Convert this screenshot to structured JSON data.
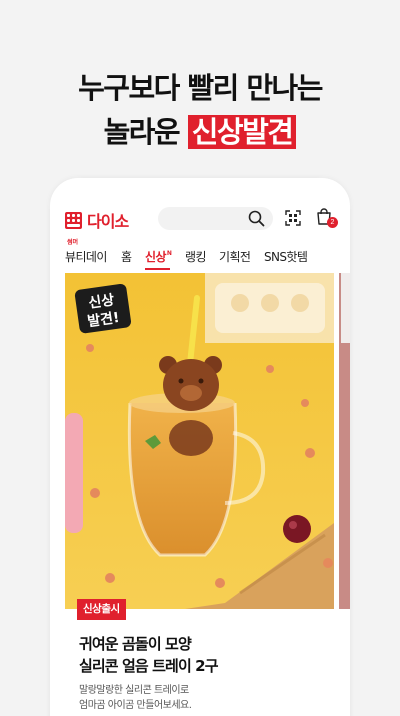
{
  "hero": {
    "line1": "누구보다 빨리 만나는",
    "line2_prefix": "놀라운 ",
    "line2_highlight": "신상발견"
  },
  "app": {
    "logo_text": "다이소",
    "cart_count": "2"
  },
  "tabs": [
    {
      "label": "뷰티데이",
      "hint": "썸머"
    },
    {
      "label": "홈"
    },
    {
      "label": "신상",
      "sup": "N",
      "active": true
    },
    {
      "label": "랭킹"
    },
    {
      "label": "기획전"
    },
    {
      "label": "SNS핫템"
    }
  ],
  "product": {
    "sticker_line1": "신상",
    "sticker_line2": "발견!",
    "tag": "신상출시",
    "title_line1": "귀여운 곰돌이 모양",
    "title_line2": "실리콘 얼음 트레이 2구",
    "desc_line1": "말랑말랑한 실리콘 트레이로",
    "desc_line2": "엄마곰 아이곰 만들어보세요."
  },
  "colors": {
    "brand_red": "#e0202d",
    "background": "#f3f3f3",
    "photo_yellow": "#f6c43a"
  },
  "icons": [
    "search-icon",
    "qr-scan-icon",
    "shopping-bag-icon"
  ]
}
